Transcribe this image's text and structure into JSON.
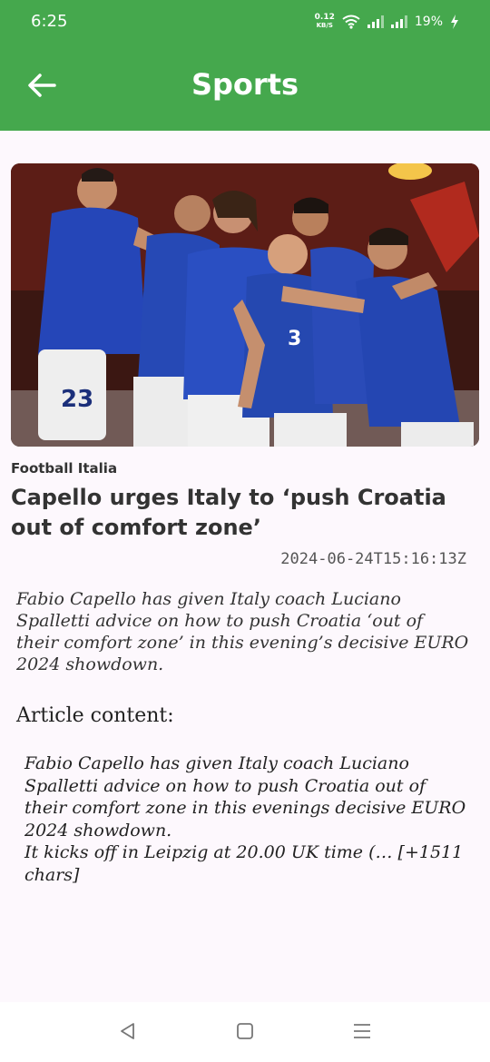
{
  "status_bar": {
    "time": "6:25",
    "net_speed_value": "0.12",
    "net_speed_unit": "KB/S",
    "battery": "19%",
    "icons": [
      "wifi-icon",
      "signal-icon",
      "signal-icon",
      "charging-icon"
    ]
  },
  "app_bar": {
    "title": "Sports",
    "back_icon": "arrow-left-icon",
    "background": "#45a84d"
  },
  "article": {
    "source": "Football Italia",
    "headline": "Capello urges Italy to ‘push Croatia out of comfort zone’",
    "published_at": "2024-06-24T15:16:13Z",
    "description": "Fabio Capello has given Italy coach Luciano Spalletti advice on how to push Croatia ‘out of their comfort zone’ in this evening’s decisive EURO 2024 showdown.",
    "content_heading": "Article content:",
    "content": "Fabio Capello has given Italy coach Luciano Spalletti advice on how to push Croatia out of their comfort zone in this evenings decisive EURO 2024 showdown.\nIt kicks off in Leipzig at 20.00 UK time (… [+1511 chars]",
    "image": {
      "jersey_number": "23",
      "jersey_number_2": "3"
    }
  },
  "nav_bar": {
    "icons": [
      "back-triangle-icon",
      "home-square-icon",
      "recents-menu-icon"
    ]
  }
}
